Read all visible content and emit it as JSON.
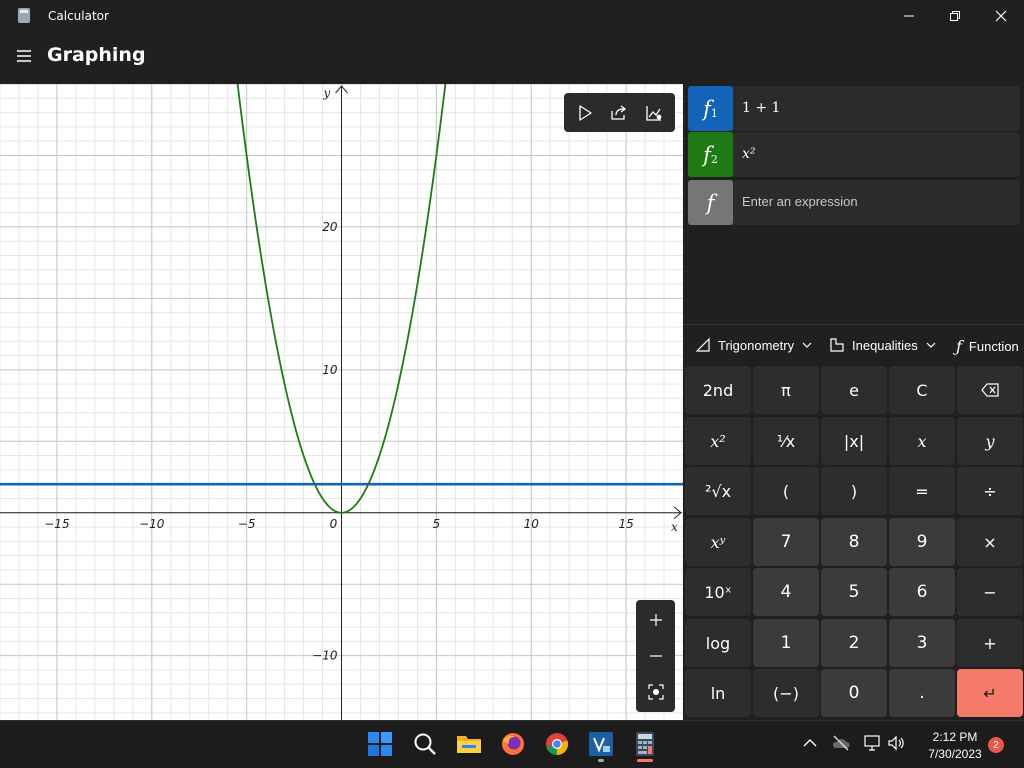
{
  "window": {
    "title": "Calculator",
    "controls": [
      "minimize",
      "maximize",
      "close"
    ]
  },
  "header": {
    "mode": "Graphing",
    "menu_icon": "hamburger-icon"
  },
  "graph": {
    "x_axis_label": "x",
    "y_axis_label": "y",
    "x_ticks": [
      "−15",
      "−10",
      "−5",
      "0",
      "5",
      "10",
      "15"
    ],
    "y_ticks": [
      "20",
      "10",
      "−10"
    ],
    "toolbar": [
      "trace-icon",
      "share-icon",
      "graph-options-icon"
    ],
    "zoom": [
      "zoom-in-icon",
      "zoom-out-icon",
      "reset-view-icon"
    ]
  },
  "chart_data": {
    "type": "line",
    "xlim": [
      -18,
      18
    ],
    "ylim": [
      -14.5,
      30
    ],
    "grid": true,
    "series": [
      {
        "expression": "1 + 1",
        "color": "#1264b8",
        "values": [
          2,
          2
        ]
      },
      {
        "expression": "x²",
        "color": "#1e7b14",
        "formula": "x^2"
      }
    ]
  },
  "functions": [
    {
      "label": "f",
      "index": "1",
      "expression": "1 + 1",
      "color": "#1264b8"
    },
    {
      "label": "f",
      "index": "2",
      "expression": "x²",
      "color": "#1e7b14"
    },
    {
      "label": "f",
      "index": "",
      "placeholder": "Enter an expression",
      "color": "#767676"
    }
  ],
  "keypad_toolbar": {
    "trigonometry": "Trigonometry",
    "inequalities": "Inequalities",
    "function": "Function"
  },
  "keypad": {
    "second": "2nd",
    "pi": "π",
    "e": "e",
    "clear": "C",
    "square": "x²",
    "reciprocal": "¹⁄x",
    "abs": "|x|",
    "x": "x",
    "y": "y",
    "root": "²√x",
    "lparen": "(",
    "rparen": ")",
    "equals": "=",
    "divide": "÷",
    "power": "xʸ",
    "seven": "7",
    "eight": "8",
    "nine": "9",
    "multiply": "×",
    "ten_power": "10ˣ",
    "four": "4",
    "five": "5",
    "six": "6",
    "minus": "−",
    "log": "log",
    "one": "1",
    "two": "2",
    "three": "3",
    "plus": "+",
    "ln": "ln",
    "negate": "(−)",
    "zero": "0",
    "decimal": ".",
    "enter": "↵"
  },
  "taskbar": {
    "apps": [
      "windows-start-icon",
      "search-icon",
      "file-explorer-icon",
      "firefox-icon",
      "chrome-icon",
      "virtualbox-icon",
      "calculator-icon"
    ],
    "time": "2:12 PM",
    "date": "7/30/2023",
    "notifications": "2"
  }
}
